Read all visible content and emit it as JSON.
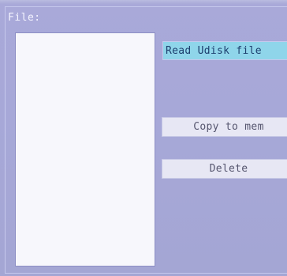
{
  "panel": {
    "file_label": "File:"
  },
  "buttons": {
    "read": "Read Udisk file",
    "copy": "Copy to mem",
    "delete": "Delete"
  },
  "colors": {
    "background": "#a8a9d8",
    "list_background": "#f7f7fc",
    "selected_button": "#8fd5ea",
    "button": "#e7e7f4"
  }
}
